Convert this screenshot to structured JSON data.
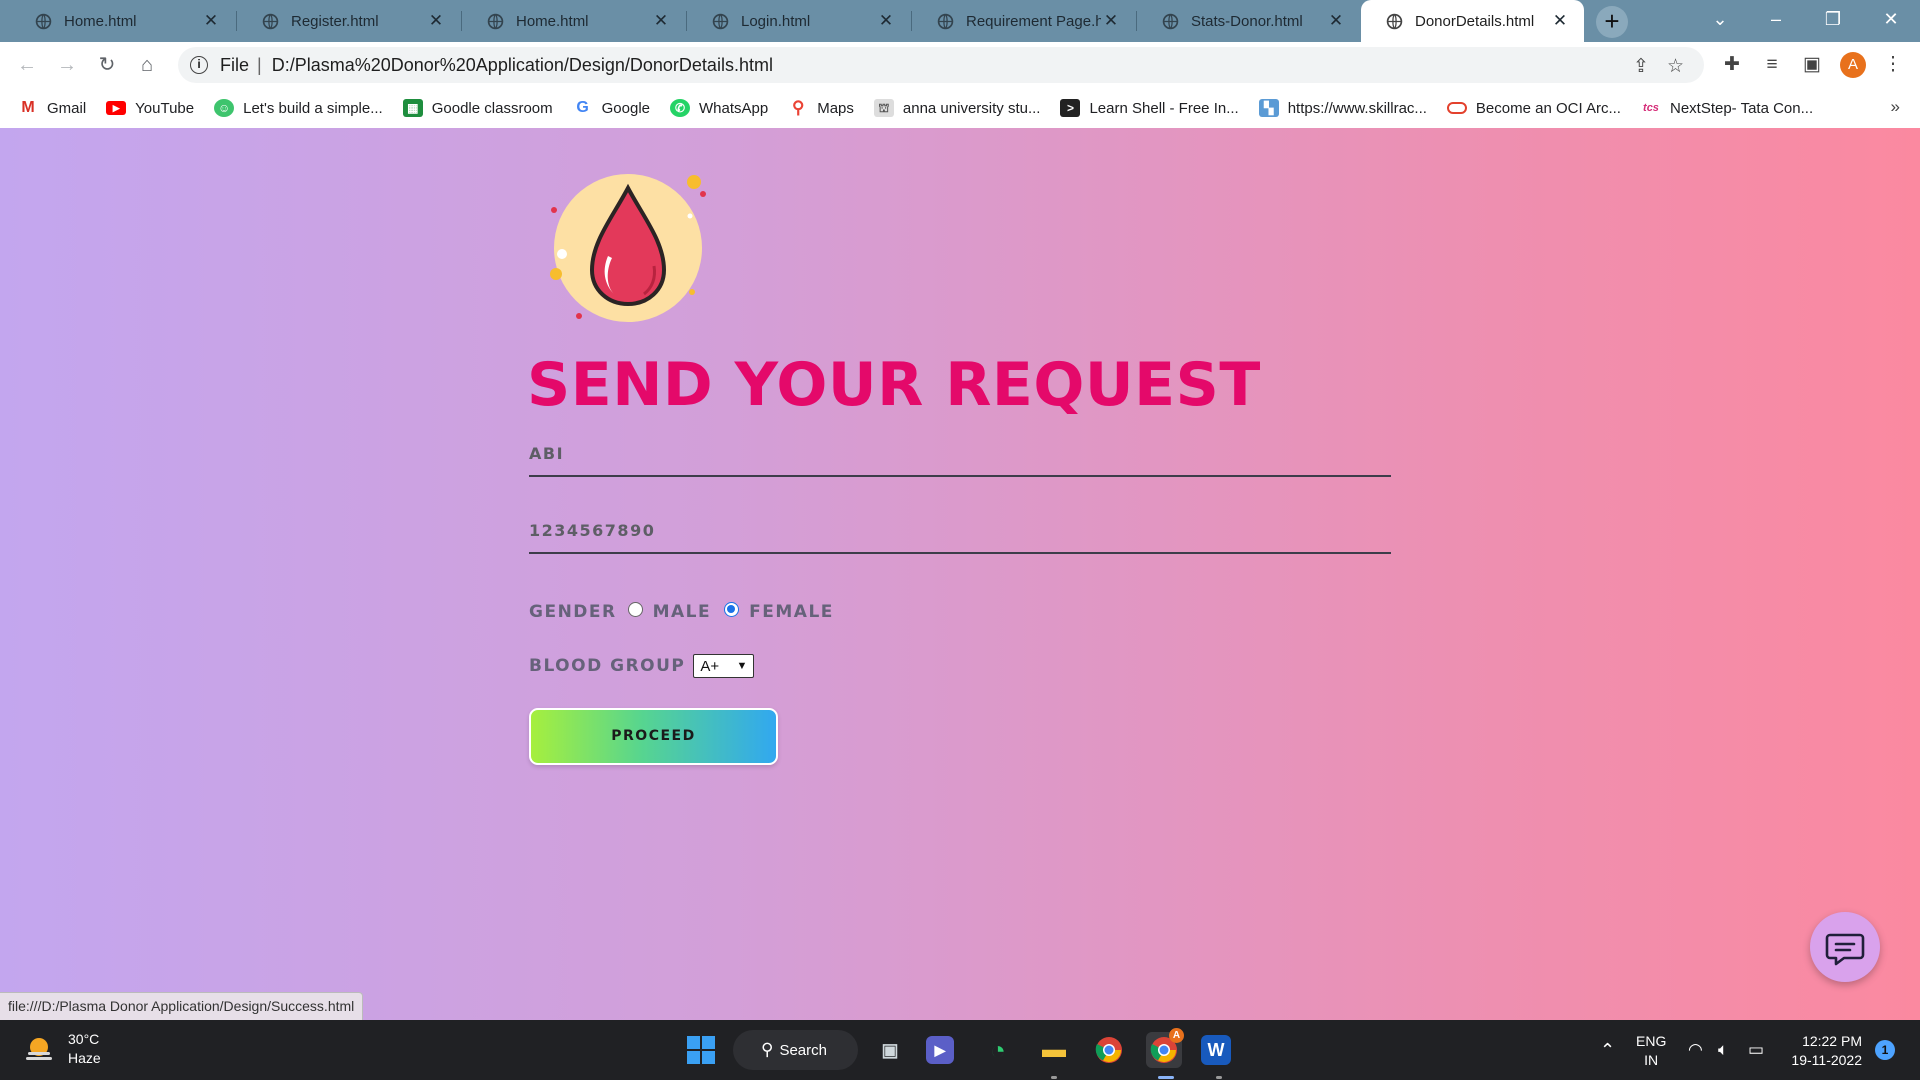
{
  "browser": {
    "tabs": [
      {
        "title": "Home.html"
      },
      {
        "title": "Register.html"
      },
      {
        "title": "Home.html"
      },
      {
        "title": "Login.html"
      },
      {
        "title": "Requirement Page.htm"
      },
      {
        "title": "Stats-Donor.html"
      },
      {
        "title": "DonorDetails.html",
        "active": true
      }
    ],
    "address": {
      "scheme": "File",
      "url": "D:/Plasma%20Donor%20Application/Design/DonorDetails.html"
    },
    "profile_initial": "A",
    "bookmarks": [
      {
        "label": "Gmail",
        "icon": "gmail-icon"
      },
      {
        "label": "YouTube",
        "icon": "youtube-icon"
      },
      {
        "label": "Let's build a simple...",
        "icon": "robot-icon"
      },
      {
        "label": "Goodle classroom",
        "icon": "classroom-icon"
      },
      {
        "label": "Google",
        "icon": "google-icon"
      },
      {
        "label": "WhatsApp",
        "icon": "whatsapp-icon"
      },
      {
        "label": "Maps",
        "icon": "maps-pin-icon"
      },
      {
        "label": "anna university stu...",
        "icon": "university-icon"
      },
      {
        "label": "Learn Shell - Free In...",
        "icon": "terminal-icon"
      },
      {
        "label": "https://www.skillrac...",
        "icon": "skillrack-icon"
      },
      {
        "label": "Become an OCI Arc...",
        "icon": "oracle-icon"
      },
      {
        "label": "NextStep- Tata Con...",
        "icon": "tcs-icon"
      }
    ],
    "status_bar_url": "file:///D:/Plasma Donor Application/Design/Success.html"
  },
  "page": {
    "title": "SEND YOUR REQUEST",
    "name_value": "ABI",
    "phone_value": "1234567890",
    "gender_label": "GENDER",
    "gender_options": [
      "MALE",
      "FEMALE"
    ],
    "gender_selected": "FEMALE",
    "blood_group_label": "BLOOD GROUP",
    "blood_group_value": "A+",
    "proceed_label": "PROCEED",
    "colors": {
      "title": "#e4096a",
      "gradient_start": "#c3a6ef",
      "gradient_end": "#fb89a0"
    }
  },
  "taskbar": {
    "weather_temp": "30°C",
    "weather_desc": "Haze",
    "search_label": "Search",
    "lang_primary": "ENG",
    "lang_secondary": "IN",
    "time": "12:22 PM",
    "date": "19-11-2022",
    "notification_count": "1",
    "chrome_badge": "A",
    "word_letter": "W"
  }
}
